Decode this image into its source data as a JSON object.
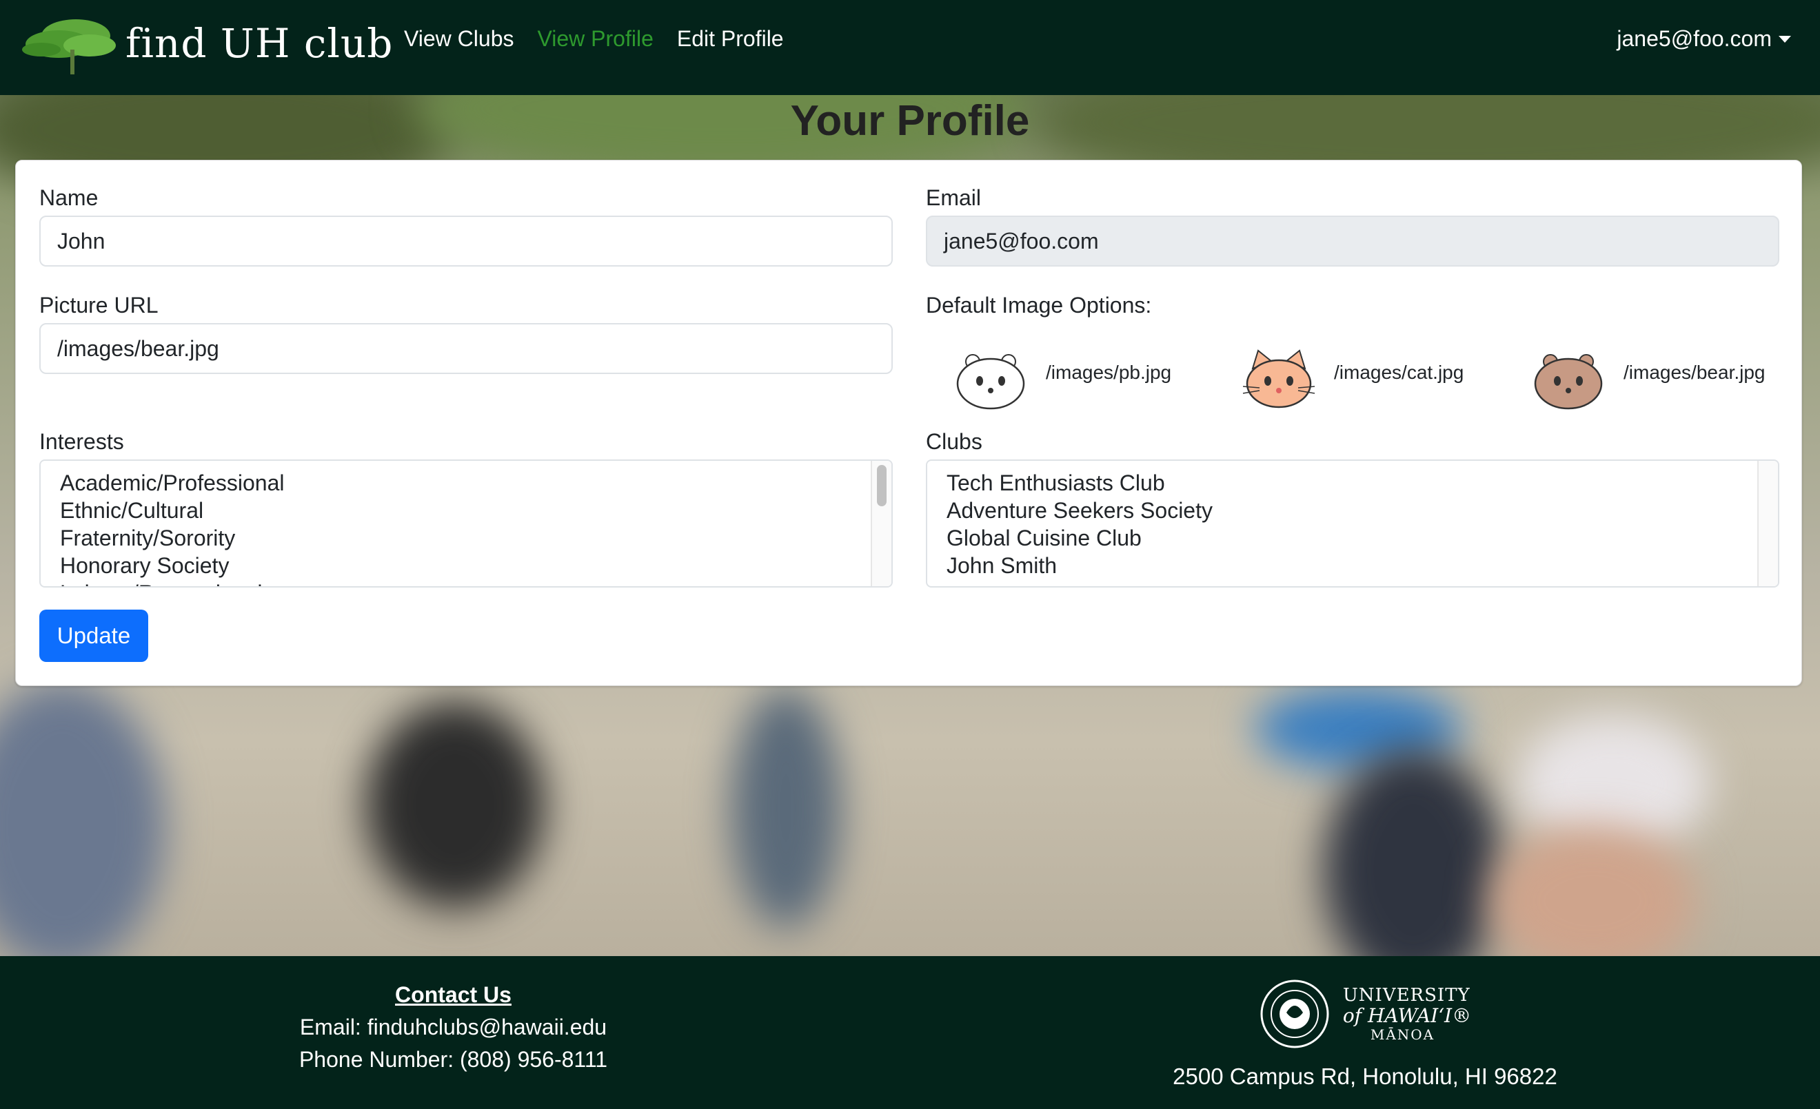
{
  "navbar": {
    "brand": "find UH club",
    "links": [
      {
        "label": "View Clubs",
        "active": false
      },
      {
        "label": "View Profile",
        "active": true
      },
      {
        "label": "Edit Profile",
        "active": false
      }
    ],
    "user": "jane5@foo.com"
  },
  "page_title": "Your Profile",
  "form": {
    "name_label": "Name",
    "name_value": "John",
    "email_label": "Email",
    "email_value": "jane5@foo.com",
    "picture_label": "Picture URL",
    "picture_value": "/images/bear.jpg",
    "default_images_label": "Default Image Options:",
    "default_images": [
      {
        "path": "/images/pb.jpg",
        "icon": "white-bear-icon"
      },
      {
        "path": "/images/cat.jpg",
        "icon": "orange-cat-icon"
      },
      {
        "path": "/images/bear.jpg",
        "icon": "brown-bear-icon"
      }
    ],
    "interests_label": "Interests",
    "interests": [
      "Academic/Professional",
      "Ethnic/Cultural",
      "Fraternity/Sorority",
      "Honorary Society",
      "Leisure/Recreational"
    ],
    "clubs_label": "Clubs",
    "clubs": [
      "Tech Enthusiasts Club",
      "Adventure Seekers Society",
      "Global Cuisine Club",
      "John Smith"
    ],
    "update_label": "Update"
  },
  "footer": {
    "contact_title": "Contact Us",
    "email_line": "Email: finduhclubs@hawaii.edu",
    "phone_line": "Phone Number: (808) 956-8111",
    "uh_line1": "UNIVERSITY",
    "uh_line2": "of HAWAI‘I®",
    "uh_line3": "MĀNOA",
    "address": "2500 Campus Rd, Honolulu, HI 96822"
  },
  "colors": {
    "navbar_bg": "#03231a",
    "active_link": "#2e9a2e",
    "primary_button": "#0d6efd"
  }
}
